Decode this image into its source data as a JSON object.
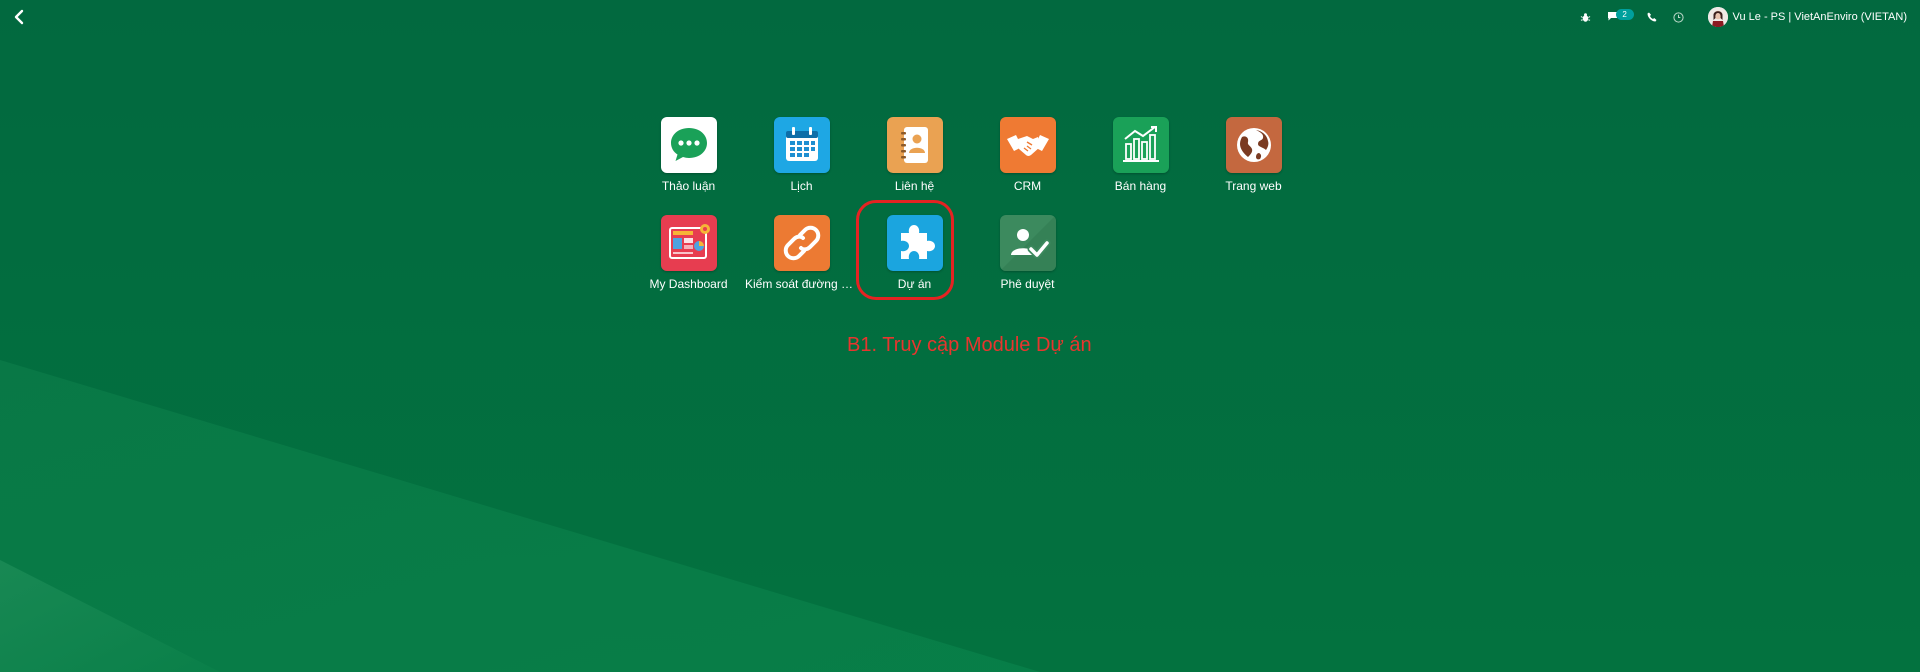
{
  "topbar": {
    "message_badge": "2",
    "user_name": "Vu Le - PS | VietAnEnviro (VIETAN)"
  },
  "apps": [
    {
      "label": "Thảo luận",
      "icon": "discuss-icon",
      "color": "#ffffff"
    },
    {
      "label": "Lịch",
      "icon": "calendar-icon",
      "color": "#1ea7e4"
    },
    {
      "label": "Liên hệ",
      "icon": "contacts-icon",
      "color": "#eaa252"
    },
    {
      "label": "CRM",
      "icon": "crm-handshake-icon",
      "color": "#ef7a33"
    },
    {
      "label": "Bán hàng",
      "icon": "sales-chart-icon",
      "color": "#1aa158"
    },
    {
      "label": "Trang web",
      "icon": "website-globe-icon",
      "color": "#c4683f"
    },
    {
      "label": "My Dashboard",
      "icon": "dashboard-icon",
      "color": "#e73d50"
    },
    {
      "label": "Kiểm soát đường dẫn",
      "icon": "link-tracker-icon",
      "color": "#ec7a33"
    },
    {
      "label": "Dự án",
      "icon": "project-puzzle-icon",
      "color": "#1ba5df"
    },
    {
      "label": "Phê duyệt",
      "icon": "approvals-icon",
      "color": "#3c8a5e"
    }
  ],
  "annotation": {
    "instruction": "B1. Truy cập Module Dự án",
    "color": "#e8352e"
  }
}
